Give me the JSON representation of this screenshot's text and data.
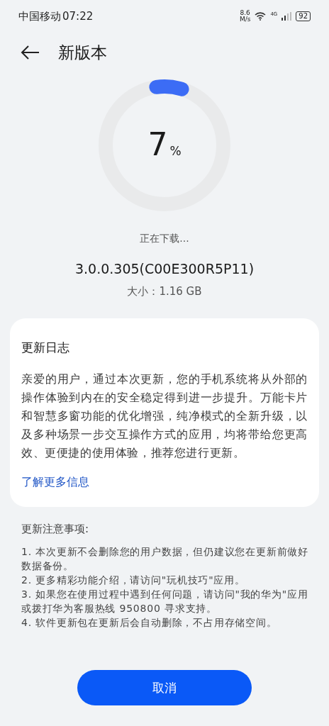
{
  "status_bar": {
    "carrier": "中国移动",
    "time": "07:22",
    "net_speed_value": "8.6",
    "net_speed_unit": "M/s",
    "network_type": "4G",
    "battery": "92"
  },
  "header": {
    "title": "新版本"
  },
  "download": {
    "percent": "7",
    "percent_sign": "%",
    "status": "正在下载...",
    "version": "3.0.0.305(C00E300R5P11)",
    "size": "大小：1.16 GB"
  },
  "changelog": {
    "title": "更新日志",
    "body": "亲爱的用户，通过本次更新，您的手机系统将从外部的操作体验到内在的安全稳定得到进一步提升。万能卡片和智慧多窗功能的优化增强，纯净模式的全新升级，以及多种场景一步交互操作方式的应用，均将带给您更高效、更便捷的使用体验，推荐您进行更新。",
    "link": "了解更多信息"
  },
  "notes": {
    "title": "更新注意事项:",
    "items": [
      "1. 本次更新不会删除您的用户数据，但仍建议您在更新前做好数据备份。",
      "2. 更多精彩功能介绍，请访问\"玩机技巧\"应用。",
      "3. 如果您在使用过程中遇到任何问题，请访问\"我的华为\"应用或拨打华为客服热线 950800 寻求支持。",
      "4. 软件更新包在更新后会自动删除，不占用存储空间。"
    ]
  },
  "buttons": [
    "取消"
  ]
}
